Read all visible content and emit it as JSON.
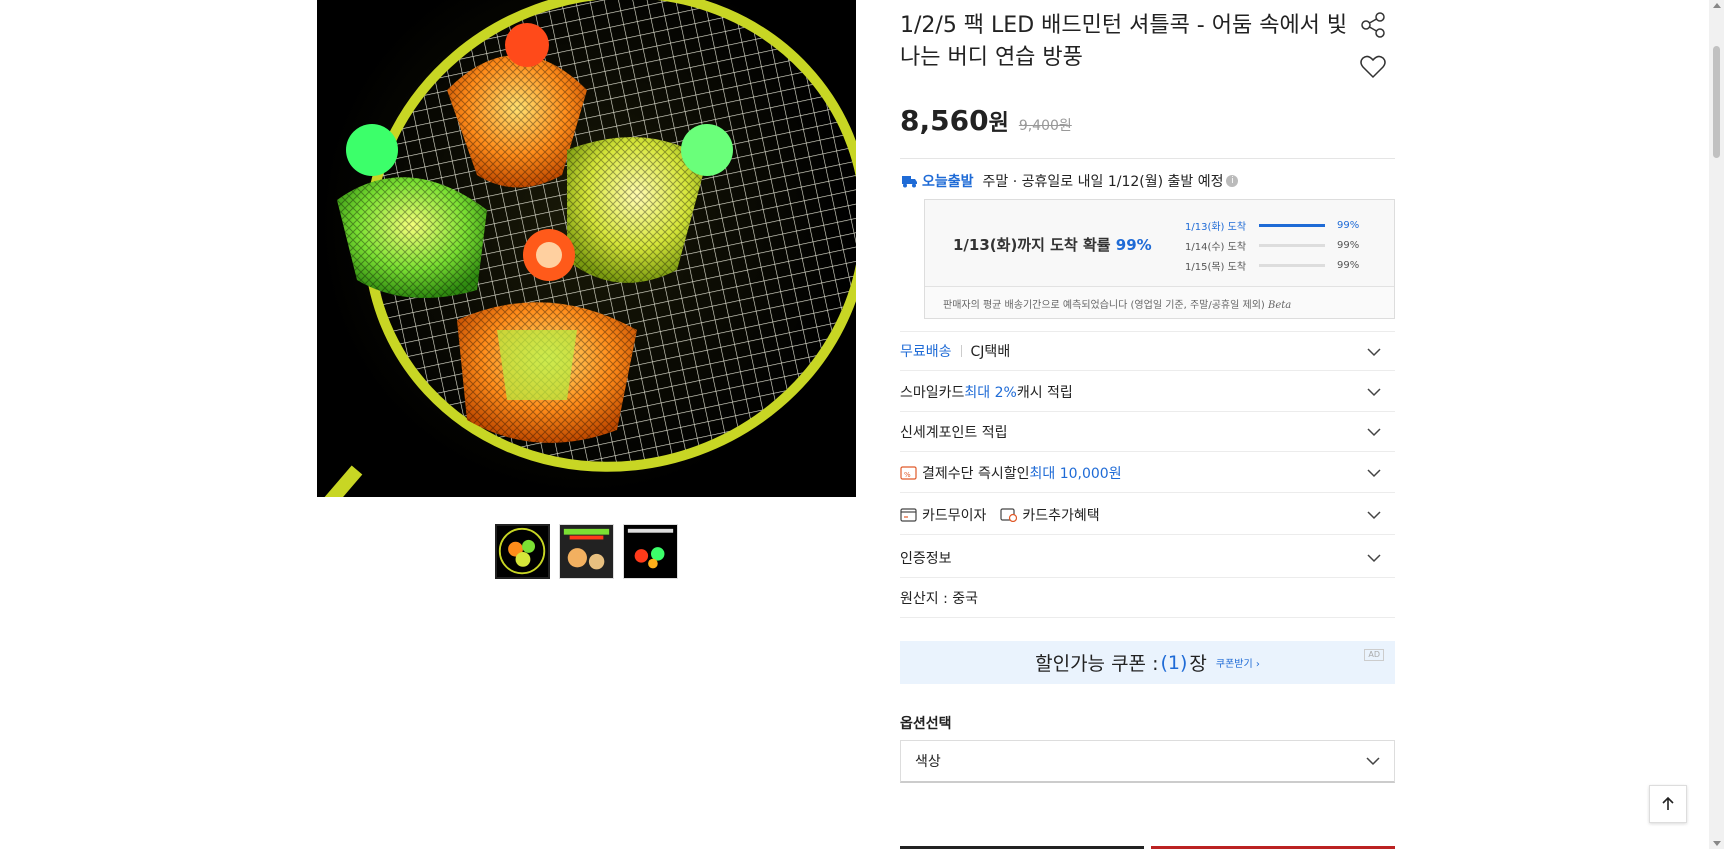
{
  "product": {
    "title": "1/2/5 팩 LED 배드민턴 셔틀콕 - 어둠 속에서 빛나는 버디 연습 방풍",
    "price": "8,560",
    "price_unit": "원",
    "original_price": "9,400원"
  },
  "shipping": {
    "badge": "오늘출발",
    "text": "주말 · 공휴일로 내일 1/12(월) 출발 예정",
    "info_icon": "i",
    "eta_main": "1/13(화)까지 도착 확률 ",
    "eta_main_pct": "99%",
    "eta_items": [
      {
        "date": "1/13(화) 도착",
        "pct": "99%",
        "level": 1.0
      },
      {
        "date": "1/14(수) 도착",
        "pct": "99%",
        "level": 0.0
      },
      {
        "date": "1/15(목) 도착",
        "pct": "99%",
        "level": 0.0
      }
    ],
    "eta_note": "판매자의 평균 배송기간으로 예측되었습니다 (영업일 기준, 주말/공휴일 제외)",
    "eta_beta": "Beta"
  },
  "rows": {
    "delivery_free": "무료배송",
    "delivery_courier": "CJ택배",
    "smilecard_prefix": "스마일카드 ",
    "smilecard_highlight": "최대 2%",
    "smilecard_suffix": " 캐시 적립",
    "shinsegae": "신세계포인트 적립",
    "payment_discount": "결제수단 즉시할인 ",
    "payment_highlight": "최대 10,000원",
    "card_interest": "카드무이자",
    "card_extra": "카드추가혜택",
    "certification": "인증정보",
    "origin": "원산지 : 중국"
  },
  "coupon": {
    "label": "할인가능 쿠폰 : ",
    "open": "(",
    "count": "1",
    "close": ")",
    "unit": "장",
    "get": "쿠폰받기 ›",
    "ad": "AD"
  },
  "options": {
    "label": "옵션선택",
    "select_value": "색상"
  },
  "colors": {
    "accent": "#1f6bd6",
    "coupon_bg": "#eaf3fd"
  }
}
